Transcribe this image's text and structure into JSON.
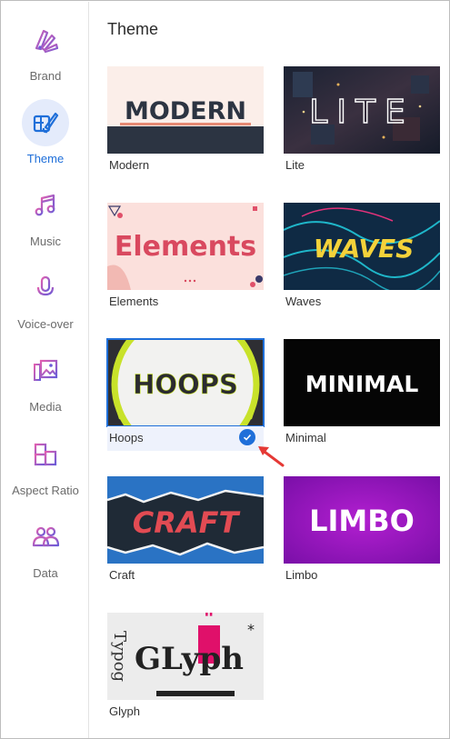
{
  "sidebar": {
    "items": [
      {
        "label": "Brand",
        "icon": "brand-palette-icon"
      },
      {
        "label": "Theme",
        "icon": "theme-brush-icon",
        "active": true
      },
      {
        "label": "Music",
        "icon": "music-note-icon"
      },
      {
        "label": "Voice-over",
        "icon": "microphone-icon"
      },
      {
        "label": "Media",
        "icon": "media-images-icon"
      },
      {
        "label": "Aspect Ratio",
        "icon": "aspect-ratio-icon"
      },
      {
        "label": "Data",
        "icon": "data-users-icon"
      }
    ]
  },
  "main": {
    "title": "Theme",
    "themes": [
      {
        "name": "Modern",
        "thumb_text": "MODERN"
      },
      {
        "name": "Lite",
        "thumb_text": "LITE"
      },
      {
        "name": "Elements",
        "thumb_text": "Elements"
      },
      {
        "name": "Waves",
        "thumb_text": "WAVES"
      },
      {
        "name": "Hoops",
        "thumb_text": "HOOPS",
        "selected": true
      },
      {
        "name": "Minimal",
        "thumb_text": "MINIMAL"
      },
      {
        "name": "Craft",
        "thumb_text": "CRAFT"
      },
      {
        "name": "Limbo",
        "thumb_text": "LIMBO"
      },
      {
        "name": "Glyph",
        "thumb_text": "GLyph"
      }
    ]
  },
  "colors": {
    "accent": "#1f6fd9",
    "active_bg": "#e4ebfb",
    "icon_gradient_start": "#e05fb0",
    "icon_gradient_end": "#6a5bd8",
    "annotation_arrow": "#e53935"
  }
}
